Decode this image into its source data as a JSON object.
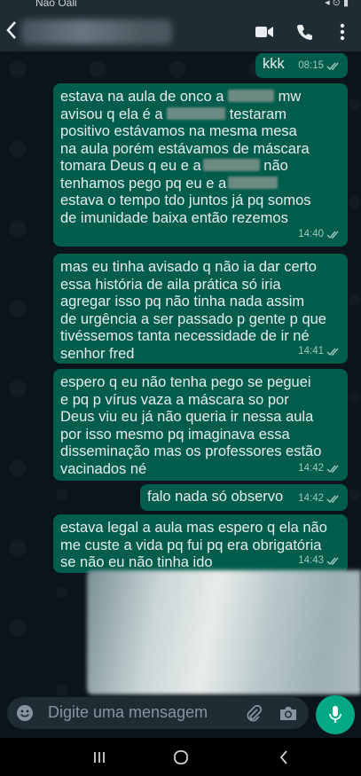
{
  "status_bar": {
    "carrier": "Não Oali",
    "icons": "◂ ⊙ ▮"
  },
  "header": {
    "back_icon": "arrow-left-icon",
    "video_icon": "video-call-icon",
    "call_icon": "phone-icon",
    "menu_icon": "more-vert-icon"
  },
  "messages": [
    {
      "text": "kkk",
      "time": "08:15"
    },
    {
      "line1a": "estava na aula de onco a",
      "line1b": "mw",
      "line2a": "avisou q ela é a",
      "line2b": "testaram",
      "line3": "positivo estávamos na mesma mesa",
      "line4": "na aula porém estávamos de máscara",
      "line5a": "tomara Deus q eu e a",
      "line5b": "não",
      "line6": "tenhamos pego pq eu e a",
      "line7": "estava o tempo tdo juntos já pq somos",
      "line8": "de imunidade baixa então rezemos",
      "time": "14:40"
    },
    {
      "text": "mas eu tinha avisado q não ia dar certo\nessa história de aila prática só iria\nagregar isso pq não tinha nada assim\nde urgência a ser passado p gente p que\ntivéssemos tanta necessidade de ir né\nsenhor fred",
      "time": "14:41"
    },
    {
      "text": "espero q eu não tenha pego se peguei\ne pq p vírus vaza a  máscara so por\nDeus viu eu já não queria ir nessa aula\npor isso mesmo pq imaginava essa\ndisseminação mas os professores estão\nvacinados né",
      "time": "14:42"
    },
    {
      "text": "falo nada só observo",
      "time": "14:42"
    },
    {
      "text": "estava legal a aula mas espero q ela não\nme custe a vida pq fui pq era obrigatória\nse não eu não tinha ido",
      "time": "14:43"
    }
  ],
  "input": {
    "placeholder": "Digite uma mensagem"
  },
  "colors": {
    "bubble_out": "#005c4b",
    "accent": "#00a884",
    "tick_read": "#9fc9bd"
  }
}
